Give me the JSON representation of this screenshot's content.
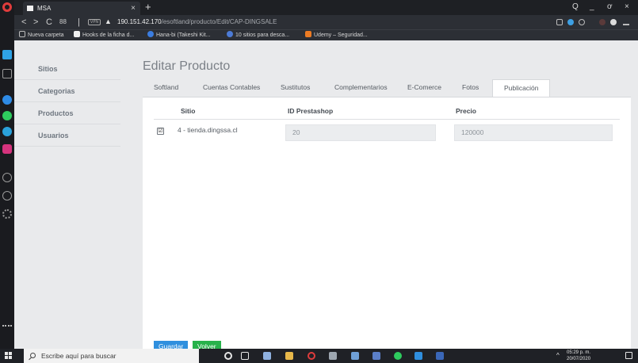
{
  "browser": {
    "tab_title": "MSA",
    "new_tab_symbol": "+",
    "tab_close_symbol": "×",
    "window_controls": {
      "search": "Q",
      "minimize": "_",
      "maximize": "ơ",
      "close": "×"
    },
    "nav": {
      "back": "<",
      "forward": ">",
      "reload": "C",
      "speed_dial": "88",
      "separator": "|"
    },
    "vpn_label": "VPN",
    "url_host": "190.151.42.170",
    "url_path": "/esoftland/producto/Edit/CAP-DINGSALE",
    "bookmarks": [
      {
        "label": "Nueva carpeta",
        "icon": "folder-icon",
        "color": "#bcbcbc"
      },
      {
        "label": "Hooks de la ficha d...",
        "icon": "bookmark-v-icon",
        "color": "#f0f0f0"
      },
      {
        "label": "Hana-bi (Takeshi Kit...",
        "icon": "hana-bi-icon",
        "color": "#3b7de0"
      },
      {
        "label": "10 sitios para desca...",
        "icon": "gamepad-icon",
        "color": "#4c7bd6"
      },
      {
        "label": "Udemy – Seguridad...",
        "icon": "udemy-icon",
        "color": "#ec7b23"
      }
    ]
  },
  "app": {
    "nav_items": [
      "Sitios",
      "Categorias",
      "Productos",
      "Usuarios"
    ],
    "page_title": "Editar Producto",
    "tabs": [
      "Softland",
      "Cuentas Contables",
      "Sustitutos",
      "Complementarios",
      "E-Comerce",
      "Fotos",
      "Publicación"
    ],
    "active_tab": "Publicación",
    "table": {
      "headers": {
        "site": "Sitio",
        "id": "ID Prestashop",
        "price": "Precio"
      },
      "rows": [
        {
          "checked": true,
          "check_symbol": "☑",
          "site": "4 - tienda.dingssa.cl",
          "id": "20",
          "price": "120000"
        }
      ]
    },
    "buttons": {
      "save": "Guardar",
      "back": "Volver"
    },
    "accent_colors": {
      "primary": "#2f8fde",
      "success": "#28b24b"
    }
  },
  "taskbar": {
    "search_placeholder": "Escribe aquí para buscar",
    "time": "05:29 p. m.",
    "date": "20/07/2020",
    "tray_caret": "^"
  }
}
